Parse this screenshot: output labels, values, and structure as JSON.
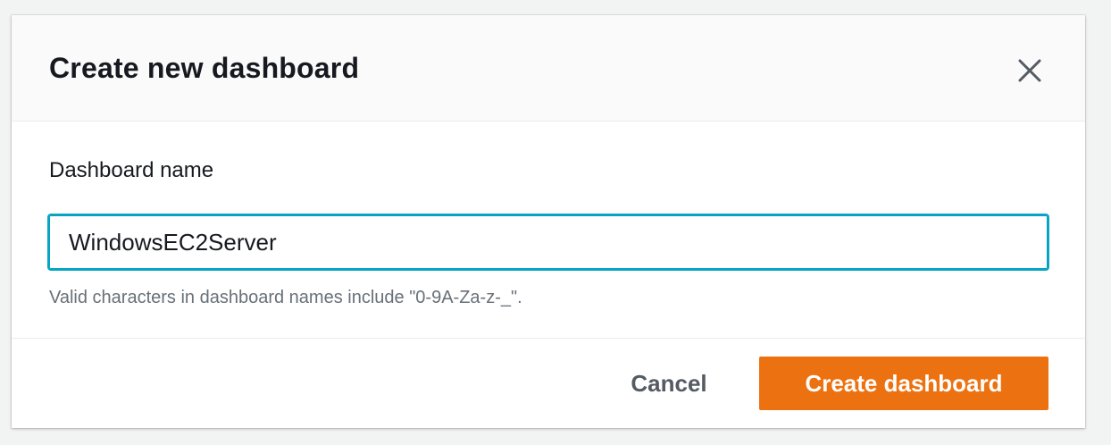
{
  "modal": {
    "title": "Create new dashboard",
    "close_icon": "close-icon"
  },
  "form": {
    "name_label": "Dashboard name",
    "name_value": "WindowsEC2Server",
    "hint": "Valid characters in dashboard names include \"0-9A-Za-z-_\"."
  },
  "footer": {
    "cancel_label": "Cancel",
    "create_label": "Create dashboard"
  },
  "colors": {
    "primary": "#ec7211",
    "focus": "#0aa5c1",
    "text": "#16191f",
    "muted": "#687078"
  }
}
